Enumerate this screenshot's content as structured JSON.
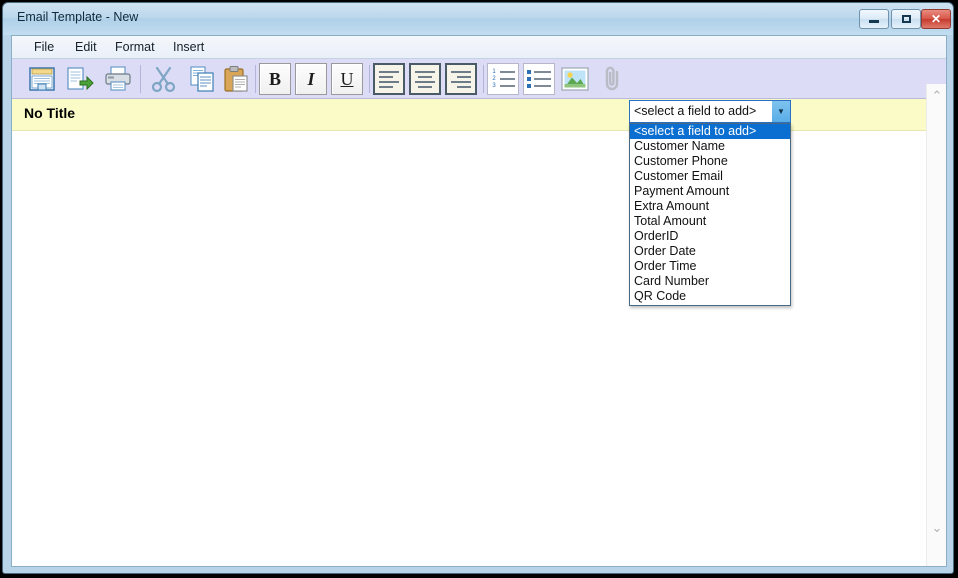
{
  "window": {
    "title": "Email Template - New",
    "controls": {
      "minimize": "Minimize",
      "maximize": "Maximize",
      "close": "✕"
    }
  },
  "menubar": {
    "items": [
      {
        "label": "File"
      },
      {
        "label": "Edit"
      },
      {
        "label": "Format"
      },
      {
        "label": "Insert"
      }
    ]
  },
  "toolbar": {
    "buttons": [
      {
        "name": "save-icon",
        "tip": "Save"
      },
      {
        "name": "save-as-icon",
        "tip": "Save As"
      },
      {
        "name": "print-icon",
        "tip": "Print"
      },
      {
        "name": "cut-icon",
        "tip": "Cut"
      },
      {
        "name": "copy-icon",
        "tip": "Copy"
      },
      {
        "name": "paste-icon",
        "tip": "Paste"
      },
      {
        "name": "bold-icon",
        "tip": "Bold",
        "glyph": "B"
      },
      {
        "name": "italic-icon",
        "tip": "Italic",
        "glyph": "I"
      },
      {
        "name": "underline-icon",
        "tip": "Underline",
        "glyph": "U"
      },
      {
        "name": "align-left-icon",
        "tip": "Align Left"
      },
      {
        "name": "align-center-icon",
        "tip": "Align Center"
      },
      {
        "name": "align-right-icon",
        "tip": "Align Right"
      },
      {
        "name": "numbered-list-icon",
        "tip": "Numbered List"
      },
      {
        "name": "bulleted-list-icon",
        "tip": "Bulleted List"
      },
      {
        "name": "insert-image-icon",
        "tip": "Insert Image"
      },
      {
        "name": "attachment-icon",
        "tip": "Attachment"
      }
    ],
    "numbered_list_markers": [
      "1",
      "2",
      "3"
    ]
  },
  "field_combo": {
    "value": "<select a field to add>",
    "arrow_glyph": "▼",
    "expanded": true,
    "options": [
      "<select a field to add>",
      "Customer Name",
      "Customer Phone",
      "Customer Email",
      "Payment Amount",
      "Extra Amount",
      "Total Amount",
      "OrderID",
      "Order Date",
      "Order Time",
      "Card Number",
      "QR Code"
    ],
    "selected_index": 0
  },
  "document": {
    "title_banner": "No Title",
    "body": ""
  },
  "scrollbar": {
    "up_glyph": "⌃",
    "down_glyph": "⌄"
  },
  "colors": {
    "toolbar_bg": "#dcdcf6",
    "title_banner_bg": "#fbfbc8",
    "window_frame": "#b9d4e8",
    "highlight": "#0a6fd0",
    "combo_border": "#2a6fc4",
    "close_button": "#c53b2e"
  }
}
